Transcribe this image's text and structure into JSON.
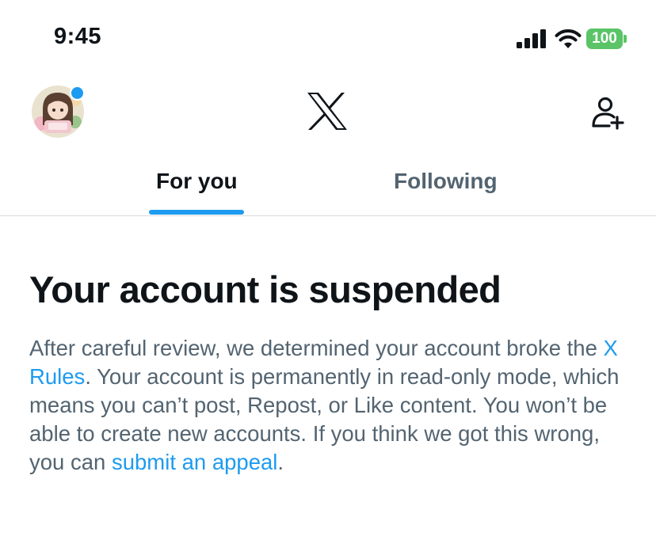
{
  "status_bar": {
    "time": "9:45",
    "battery_level": "100",
    "battery_color": "#5ac467",
    "icons": [
      "cellular-signal-icon",
      "wifi-icon",
      "battery-icon"
    ]
  },
  "header": {
    "logo": "x-logo",
    "avatar_notification_dot_color": "#1d9bf0",
    "follow_button_icon": "add-user-icon"
  },
  "tabs": [
    {
      "label": "For you",
      "active": true
    },
    {
      "label": "Following",
      "active": false
    }
  ],
  "accent_color": "#1d9bf0",
  "notice": {
    "title": "Your account is suspended",
    "body_part1": "After careful review, we determined your account broke the ",
    "rules_link": "X Rules",
    "body_part2": ". Your account is permanently in read-only mode, which means you can’t post, Repost, or Like content. You won’t be able to create new accounts. If you think we got this wrong, you can ",
    "appeal_link": "submit an appeal",
    "body_part3": "."
  }
}
